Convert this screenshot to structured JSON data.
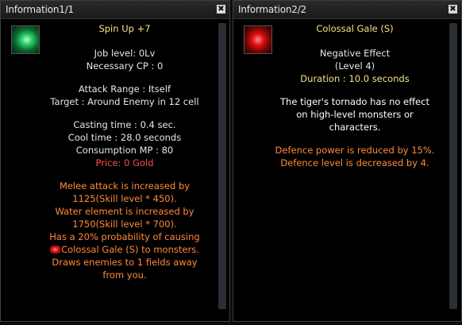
{
  "colors": {
    "name": "#f4e28a",
    "info": "#e6e6e6",
    "price": "#ff4b4b",
    "effect": "#ff8a3a"
  },
  "panel1": {
    "title": "Information1/1",
    "close_label": "✖",
    "icon": "green-swirl-skill-icon",
    "skill_name": "Spin Up +7",
    "job_level": "Job level: 0Lv",
    "necessary_cp": "Necessary CP : 0",
    "attack_range": "Attack Range : Itself",
    "target": "Target : Around Enemy in 12 cell",
    "casting_time": "Casting time : 0.4 sec.",
    "cool_time": "Cool time : 28.0 seconds",
    "consumption_mp": "Consumption MP : 80",
    "price": "Price: 0 Gold",
    "effects": [
      "Melee attack is increased by",
      "1125(Skill level * 450).",
      "Water element is increased by",
      "1750(Skill level * 700).",
      "Has a 20% probability of causing",
      "Colossal Gale (S) to monsters.",
      "Draws enemies to 1 fields away",
      "from you."
    ]
  },
  "panel2": {
    "title": "Information2/2",
    "close_label": "✖",
    "icon": "red-swirl-skill-icon",
    "skill_name": "Colossal Gale (S)",
    "type": "Negative Effect",
    "level": "(Level 4)",
    "duration": "Duration : 10.0 seconds",
    "description": [
      "The tiger's tornado has no effect",
      "on high-level monsters or",
      "characters."
    ],
    "effects": [
      "Defence power is reduced by 15%.",
      "Defence level is decreased by 4."
    ]
  }
}
